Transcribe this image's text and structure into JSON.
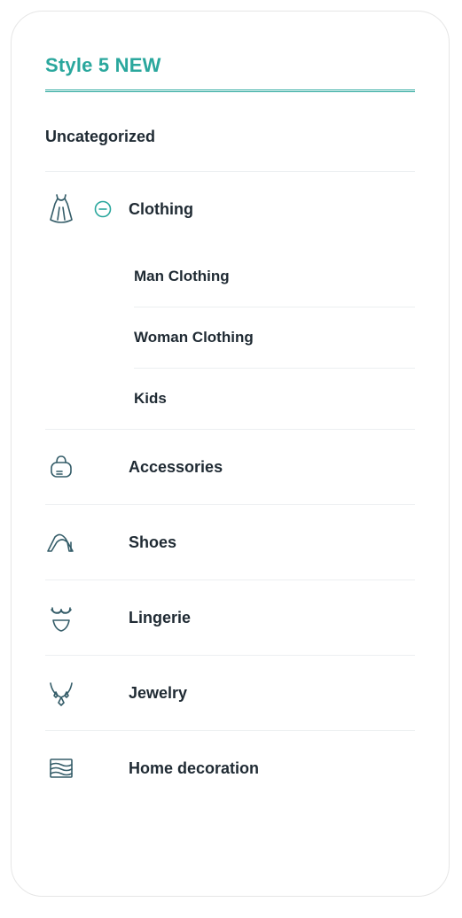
{
  "title": "Style 5 NEW",
  "uncategorized_label": "Uncategorized",
  "categories": [
    {
      "label": "Clothing",
      "expanded": true,
      "children": [
        {
          "label": "Man Clothing"
        },
        {
          "label": "Woman Clothing"
        },
        {
          "label": "Kids"
        }
      ]
    },
    {
      "label": "Accessories"
    },
    {
      "label": "Shoes"
    },
    {
      "label": "Lingerie"
    },
    {
      "label": "Jewelry"
    },
    {
      "label": "Home decoration"
    }
  ]
}
